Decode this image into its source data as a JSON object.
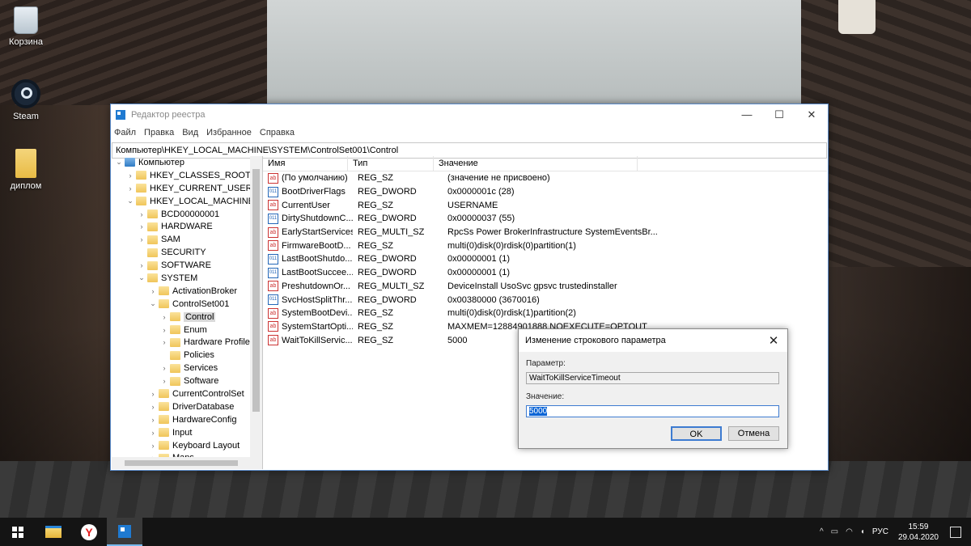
{
  "desktop": {
    "icons": [
      {
        "label": "Корзина"
      },
      {
        "label": "Steam"
      },
      {
        "label": "диплом"
      }
    ]
  },
  "window": {
    "title": "Редактор реестра",
    "minimize": "—",
    "maximize": "☐",
    "close": "✕",
    "menu": [
      "Файл",
      "Правка",
      "Вид",
      "Избранное",
      "Справка"
    ],
    "address": "Компьютер\\HKEY_LOCAL_MACHINE\\SYSTEM\\ControlSet001\\Control"
  },
  "tree": [
    {
      "label": "Компьютер",
      "arrow": "⌄",
      "indent": 0,
      "root": true
    },
    {
      "label": "HKEY_CLASSES_ROOT",
      "arrow": "›",
      "indent": 1
    },
    {
      "label": "HKEY_CURRENT_USER",
      "arrow": "›",
      "indent": 1
    },
    {
      "label": "HKEY_LOCAL_MACHINE",
      "arrow": "⌄",
      "indent": 1
    },
    {
      "label": "BCD00000001",
      "arrow": "›",
      "indent": 2
    },
    {
      "label": "HARDWARE",
      "arrow": "›",
      "indent": 2
    },
    {
      "label": "SAM",
      "arrow": "›",
      "indent": 2
    },
    {
      "label": "SECURITY",
      "arrow": "",
      "indent": 2
    },
    {
      "label": "SOFTWARE",
      "arrow": "›",
      "indent": 2
    },
    {
      "label": "SYSTEM",
      "arrow": "⌄",
      "indent": 2
    },
    {
      "label": "ActivationBroker",
      "arrow": "›",
      "indent": 3
    },
    {
      "label": "ControlSet001",
      "arrow": "⌄",
      "indent": 3
    },
    {
      "label": "Control",
      "arrow": "›",
      "indent": 4,
      "selected": true
    },
    {
      "label": "Enum",
      "arrow": "›",
      "indent": 4
    },
    {
      "label": "Hardware Profiles",
      "arrow": "›",
      "indent": 4
    },
    {
      "label": "Policies",
      "arrow": "",
      "indent": 4
    },
    {
      "label": "Services",
      "arrow": "›",
      "indent": 4
    },
    {
      "label": "Software",
      "arrow": "›",
      "indent": 4
    },
    {
      "label": "CurrentControlSet",
      "arrow": "›",
      "indent": 3
    },
    {
      "label": "DriverDatabase",
      "arrow": "›",
      "indent": 3
    },
    {
      "label": "HardwareConfig",
      "arrow": "›",
      "indent": 3
    },
    {
      "label": "Input",
      "arrow": "›",
      "indent": 3
    },
    {
      "label": "Keyboard Layout",
      "arrow": "›",
      "indent": 3
    },
    {
      "label": "Maps",
      "arrow": "›",
      "indent": 3
    }
  ],
  "list": {
    "headers": [
      "Имя",
      "Тип",
      "Значение"
    ],
    "rows": [
      {
        "icon": "ab",
        "name": "(По умолчанию)",
        "type": "REG_SZ",
        "value": "(значение не присвоено)"
      },
      {
        "icon": "dw",
        "name": "BootDriverFlags",
        "type": "REG_DWORD",
        "value": "0x0000001c (28)"
      },
      {
        "icon": "ab",
        "name": "CurrentUser",
        "type": "REG_SZ",
        "value": "USERNAME"
      },
      {
        "icon": "dw",
        "name": "DirtyShutdownC...",
        "type": "REG_DWORD",
        "value": "0x00000037 (55)"
      },
      {
        "icon": "ab",
        "name": "EarlyStartServices",
        "type": "REG_MULTI_SZ",
        "value": "RpcSs Power BrokerInfrastructure SystemEventsBr..."
      },
      {
        "icon": "ab",
        "name": "FirmwareBootD...",
        "type": "REG_SZ",
        "value": "multi(0)disk(0)rdisk(0)partition(1)"
      },
      {
        "icon": "dw",
        "name": "LastBootShutdo...",
        "type": "REG_DWORD",
        "value": "0x00000001 (1)"
      },
      {
        "icon": "dw",
        "name": "LastBootSuccee...",
        "type": "REG_DWORD",
        "value": "0x00000001 (1)"
      },
      {
        "icon": "ab",
        "name": "PreshutdownOr...",
        "type": "REG_MULTI_SZ",
        "value": "DeviceInstall UsoSvc gpsvc trustedinstaller"
      },
      {
        "icon": "dw",
        "name": "SvcHostSplitThr...",
        "type": "REG_DWORD",
        "value": "0x00380000 (3670016)"
      },
      {
        "icon": "ab",
        "name": "SystemBootDevi...",
        "type": "REG_SZ",
        "value": "multi(0)disk(0)rdisk(1)partition(2)"
      },
      {
        "icon": "ab",
        "name": "SystemStartOpti...",
        "type": "REG_SZ",
        "value": " MAXMEM=12884901888  NOEXECUTE=OPTOUT"
      },
      {
        "icon": "ab",
        "name": "WaitToKillServic...",
        "type": "REG_SZ",
        "value": "5000"
      }
    ]
  },
  "dialog": {
    "title": "Изменение строкового параметра",
    "close": "✕",
    "param_label": "Параметр:",
    "param_value": "WaitToKillServiceTimeout",
    "value_label": "Значение:",
    "value": "5000",
    "ok": "OK",
    "cancel": "Отмена"
  },
  "taskbar": {
    "yandex_letter": "Y",
    "tray_symbols": [
      "^",
      "▭",
      "◠",
      "◖"
    ],
    "language": "РУС",
    "time": "15:59",
    "date": "29.04.2020"
  }
}
